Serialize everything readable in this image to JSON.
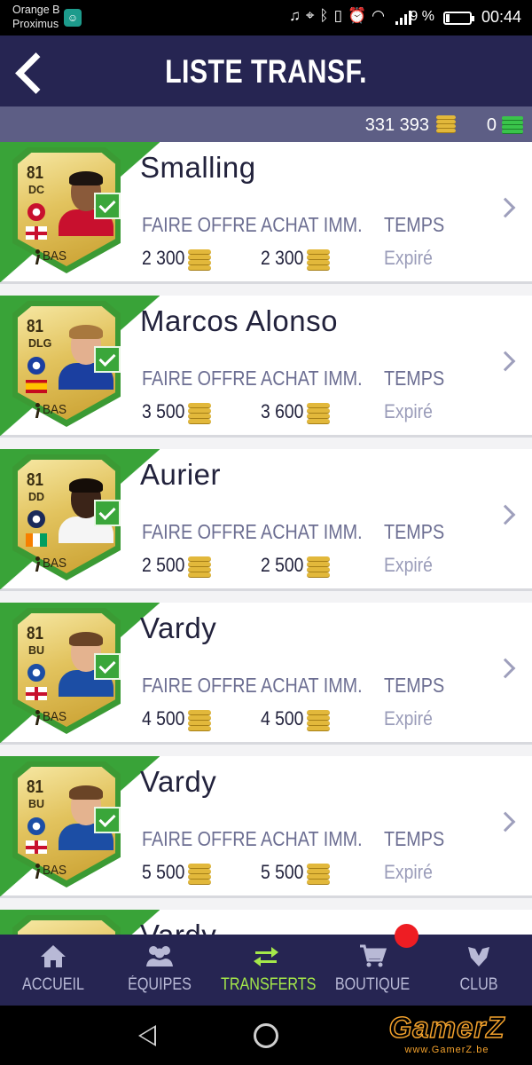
{
  "statusbar": {
    "carrier_line1": "Orange B",
    "carrier_line2": "Proximus",
    "battery_percent": "9 %",
    "time": "00:44"
  },
  "header": {
    "title": "LISTE TRANSF."
  },
  "currency": {
    "coins": "331 393",
    "points": "0"
  },
  "columns": {
    "offer_label": "FAIRE OFFRE",
    "buy_now_label": "ACHAT IMM.",
    "time_label": "TEMPS"
  },
  "players": [
    {
      "name": "Smalling",
      "rating": "81",
      "position": "DC",
      "quality": "BAS",
      "offer": "2 300",
      "buy_now": "2 300",
      "time": "Expiré",
      "club": "manchester-united-badge",
      "nation": "england-flag",
      "skin": "#8a5a3a",
      "hair": "#1d1410",
      "kit": "#c8102e"
    },
    {
      "name": "Marcos Alonso",
      "rating": "81",
      "position": "DLG",
      "quality": "BAS",
      "offer": "3 500",
      "buy_now": "3 600",
      "time": "Expiré",
      "club": "chelsea-badge",
      "nation": "spain-flag",
      "skin": "#e3b08f",
      "hair": "#a8783e",
      "kit": "#1b3fa0"
    },
    {
      "name": "Aurier",
      "rating": "81",
      "position": "DD",
      "quality": "BAS",
      "offer": "2 500",
      "buy_now": "2 500",
      "time": "Expiré",
      "club": "tottenham-badge",
      "nation": "ivory-coast-flag",
      "skin": "#3b2418",
      "hair": "#150d08",
      "kit": "#f5f5f5"
    },
    {
      "name": "Vardy",
      "rating": "81",
      "position": "BU",
      "quality": "BAS",
      "offer": "4 500",
      "buy_now": "4 500",
      "time": "Expiré",
      "club": "leicester-badge",
      "nation": "england-flag",
      "skin": "#e4b38f",
      "hair": "#6a4426",
      "kit": "#1c4ea5"
    },
    {
      "name": "Vardy",
      "rating": "81",
      "position": "BU",
      "quality": "BAS",
      "offer": "5 500",
      "buy_now": "5 500",
      "time": "Expiré",
      "club": "leicester-badge",
      "nation": "england-flag",
      "skin": "#e4b38f",
      "hair": "#6a4426",
      "kit": "#1c4ea5"
    },
    {
      "name": "Vardy",
      "rating": "",
      "position": "",
      "quality": "",
      "offer": "",
      "buy_now": "",
      "time": "",
      "club": "",
      "nation": "",
      "skin": "#e4b38f",
      "hair": "#6a4426",
      "kit": "#1c4ea5"
    }
  ],
  "nav": [
    {
      "label": "ACCUEIL",
      "icon": "home-icon",
      "active": false
    },
    {
      "label": "ÉQUIPES",
      "icon": "team-icon",
      "active": false
    },
    {
      "label": "TRANSFERTS",
      "icon": "transfer-arrows-icon",
      "active": true
    },
    {
      "label": "BOUTIQUE",
      "icon": "shopping-cart-icon",
      "active": false
    },
    {
      "label": "CLUB",
      "icon": "club-shield-icon",
      "active": false
    }
  ],
  "watermark": {
    "brand": "GamerZ",
    "url": "www.GamerZ.be"
  },
  "colors": {
    "header": "#262552",
    "accent_green": "#39a338",
    "active_nav": "#a4e84a",
    "notification": "#ee1d23"
  }
}
